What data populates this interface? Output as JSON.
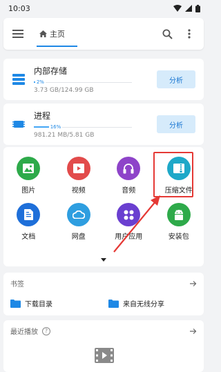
{
  "status_bar": {
    "time": "10:03"
  },
  "toolbar": {
    "home_label": "主页"
  },
  "storage": [
    {
      "title": "内部存储",
      "percent_label": "2%",
      "percent": 2,
      "size": "3.73 GB/124.99 GB",
      "button": "分析"
    },
    {
      "title": "进程",
      "percent_label": "16%",
      "percent": 16,
      "size": "981.21 MB/5.81 GB",
      "button": "分析"
    }
  ],
  "categories": [
    {
      "label": "图片",
      "color": "#2eaa4a",
      "icon": "image-icon"
    },
    {
      "label": "视频",
      "color": "#e24b4b",
      "icon": "video-play-icon"
    },
    {
      "label": "音频",
      "color": "#8e44c9",
      "icon": "headphones-icon"
    },
    {
      "label": "压缩文件",
      "color": "#1ea8c8",
      "icon": "archive-icon"
    },
    {
      "label": "文档",
      "color": "#1e6fd9",
      "icon": "document-icon"
    },
    {
      "label": "网盘",
      "color": "#2e9ee0",
      "icon": "cloud-icon"
    },
    {
      "label": "用户应用",
      "color": "#6a3fd0",
      "icon": "apps-icon"
    },
    {
      "label": "安装包",
      "color": "#2eaa4a",
      "icon": "android-icon"
    }
  ],
  "bookmarks": {
    "title": "书签",
    "items": [
      "下载目录",
      "来自无线分享"
    ]
  },
  "recent": {
    "title": "最近播放"
  },
  "colors": {
    "accent": "#1e88e5",
    "highlight": "#e53935"
  }
}
